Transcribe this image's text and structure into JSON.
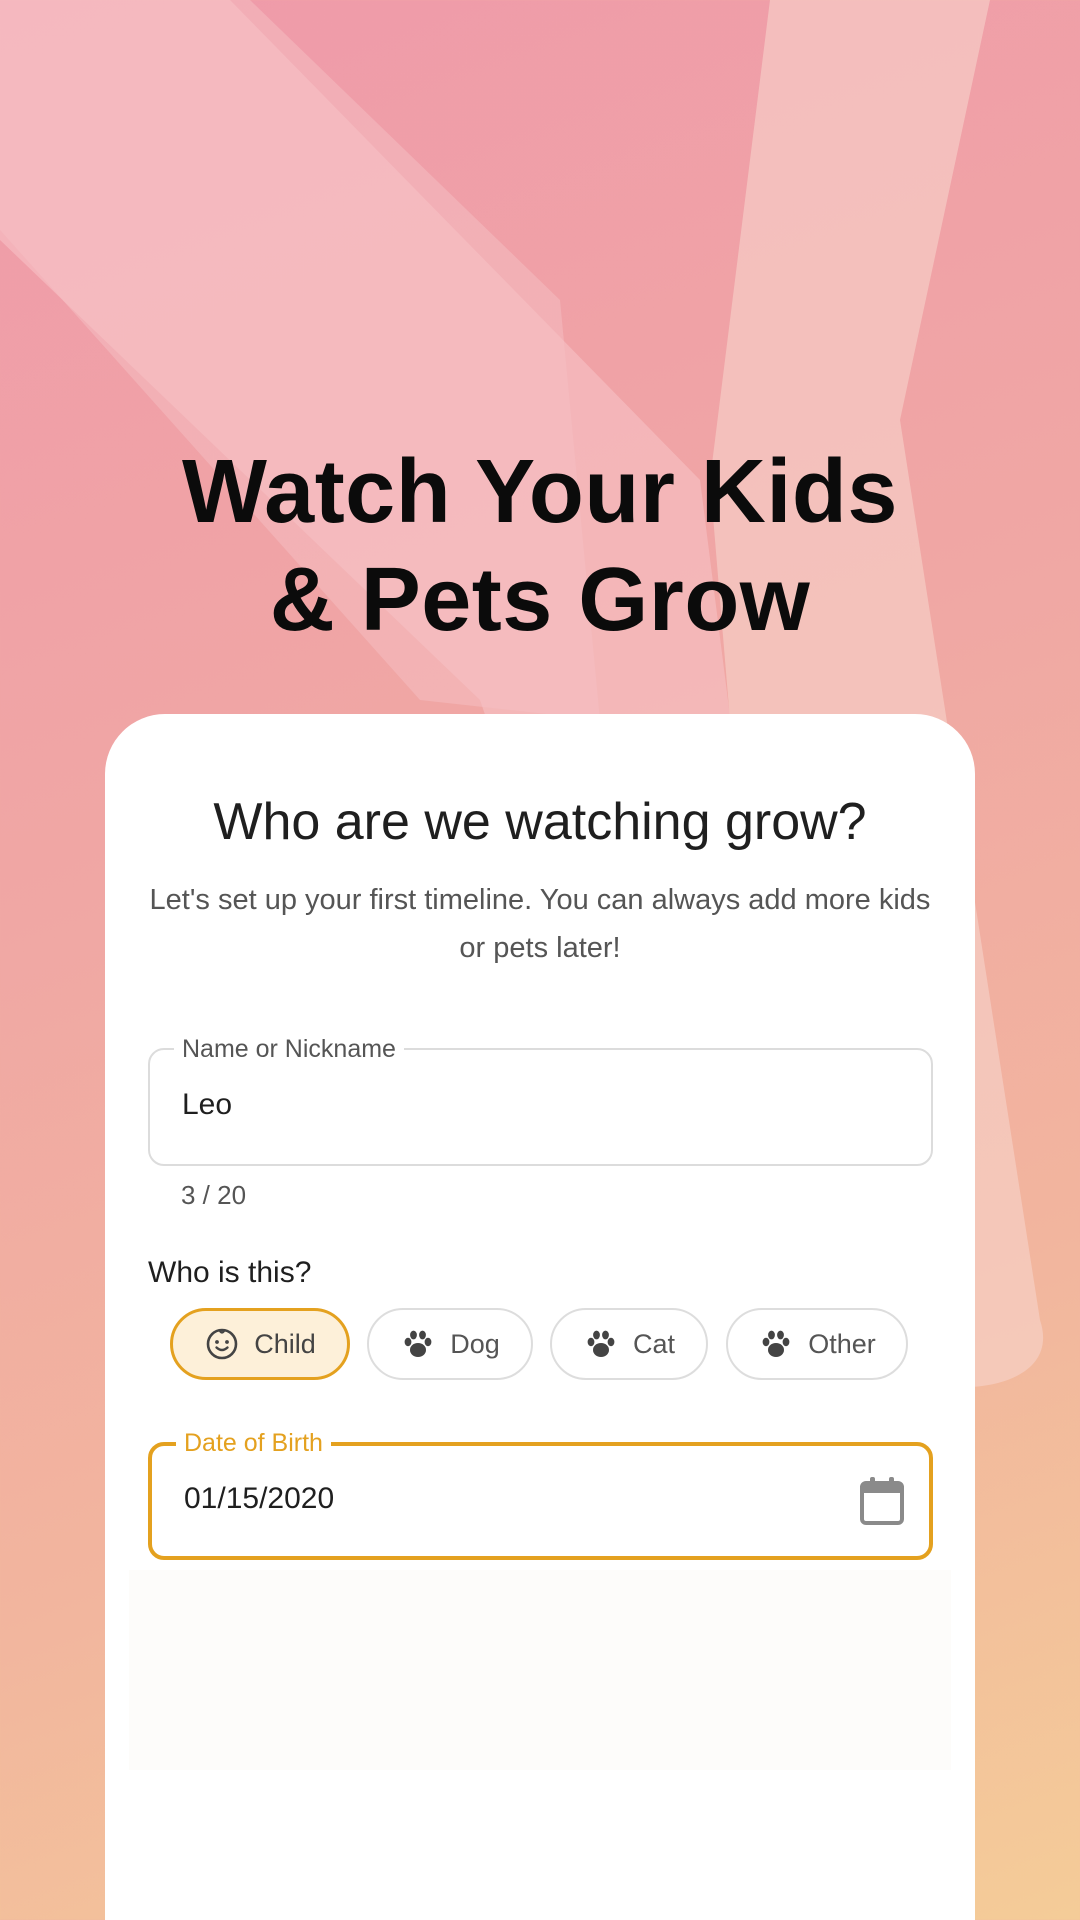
{
  "hero": {
    "line1": "Watch Your Kids",
    "line2": "& Pets Grow"
  },
  "card": {
    "title": "Who are we watching grow?",
    "subtitle": "Let's set up your first timeline. You can always add more kids or pets later!"
  },
  "name_field": {
    "label": "Name or Nickname",
    "value": "Leo",
    "counter": "3 / 20"
  },
  "type_question": "Who is this?",
  "types": [
    {
      "label": "Child",
      "icon": "baby-face-icon",
      "selected": true
    },
    {
      "label": "Dog",
      "icon": "paw-icon",
      "selected": false
    },
    {
      "label": "Cat",
      "icon": "paw-icon",
      "selected": false
    },
    {
      "label": "Other",
      "icon": "paw-icon",
      "selected": false
    }
  ],
  "dob_field": {
    "label": "Date of Birth",
    "value": "01/15/2020",
    "icon": "calendar-icon"
  },
  "colors": {
    "accent": "#e4a11f",
    "accent_bg": "#fdf0d9",
    "text_dark": "#1f1f1f",
    "text_muted": "#555555"
  }
}
